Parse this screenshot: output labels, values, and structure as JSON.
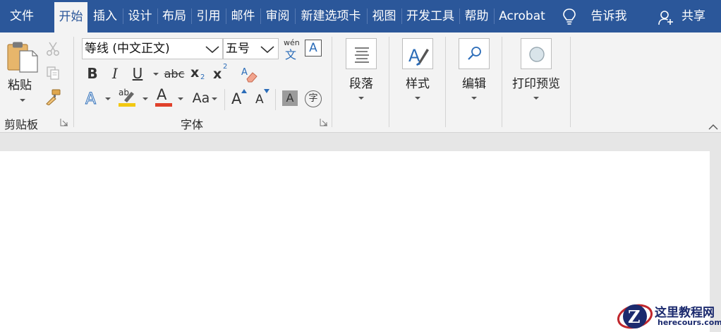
{
  "tabs": [
    {
      "label": "文件"
    },
    {
      "label": "开始"
    },
    {
      "label": "插入"
    },
    {
      "label": "设计"
    },
    {
      "label": "布局"
    },
    {
      "label": "引用"
    },
    {
      "label": "邮件"
    },
    {
      "label": "审阅"
    },
    {
      "label": "新建选项卡"
    },
    {
      "label": "视图"
    },
    {
      "label": "开发工具"
    },
    {
      "label": "帮助"
    },
    {
      "label": "Acrobat"
    }
  ],
  "tell_me": "告诉我",
  "share": "共享",
  "clipboard": {
    "paste_label": "粘贴",
    "group_label": "剪贴板"
  },
  "font": {
    "font_name": "等线 (中文正文)",
    "font_size": "五号",
    "phonetic_pinyin": "wén",
    "phonetic_char": "文",
    "char_border": "A",
    "bold": "B",
    "italic": "I",
    "underline": "U",
    "strikethrough": "abc",
    "subscript": "x",
    "subscript_mark": "2",
    "superscript": "x",
    "superscript_mark": "2",
    "highlight_text": "ab",
    "font_color_text": "A",
    "change_case": "Aa",
    "grow_font": "A",
    "shrink_font": "A",
    "char_shading": "A",
    "enclosed_char": "字",
    "group_label": "字体"
  },
  "paragraph": {
    "label": "段落"
  },
  "styles": {
    "label": "样式"
  },
  "editing": {
    "label": "编辑"
  },
  "print_preview": {
    "label": "打印预览"
  },
  "watermark": {
    "letter": "Z",
    "title": "这里教程网",
    "url": "herecours.com"
  },
  "colors": {
    "brand": "#2b579a",
    "highlight": "#f2c811",
    "font_color": "#e0412b"
  }
}
